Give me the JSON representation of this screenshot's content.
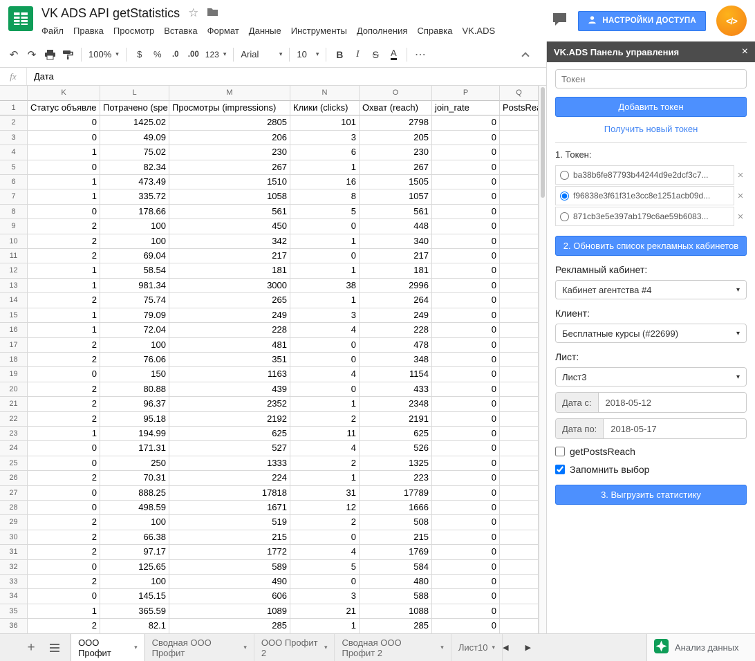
{
  "colors": {
    "accent_blue": "#4d90fe",
    "sheets_green": "#0F9D58",
    "addon_orange": "#F57F17",
    "panel_header_gray": "#4c4c4c"
  },
  "icons": {
    "star": "☆",
    "undo": "↶",
    "redo": "↷",
    "caret_down": "▾",
    "prev": "◀",
    "next": "▶",
    "plus": "+"
  },
  "header": {
    "title": "VK ADS API getStatistics",
    "menus": [
      "Файл",
      "Правка",
      "Просмотр",
      "Вставка",
      "Формат",
      "Данные",
      "Инструменты",
      "Дополнения",
      "Справка",
      "VK.ADS"
    ],
    "share_button": "НАСТРОЙКИ ДОСТУПА",
    "addon_icon": "</>"
  },
  "toolbar": {
    "zoom": "100%",
    "currency": "$",
    "percent": "%",
    "decrease_decimal": ".0",
    "increase_decimal": ".00",
    "more_formats": "123",
    "font": "Arial",
    "font_size": "10",
    "bold": "B",
    "italic": "I",
    "strikethrough": "S",
    "text_color": "A",
    "more": "⋯"
  },
  "formula_bar": {
    "fx": "fx",
    "value": "Дата"
  },
  "grid": {
    "columns": [
      "K",
      "L",
      "M",
      "N",
      "O",
      "P",
      "Q"
    ],
    "header_row": {
      "row": 1,
      "cells": [
        "Статус объявле",
        "Потрачено (spe",
        "Просмотры (impressions)",
        "Клики (clicks)",
        "Охват (reach)",
        "join_rate",
        "PostsRea"
      ]
    },
    "rows": [
      {
        "n": 2,
        "cells": [
          "0",
          "1425.02",
          "2805",
          "101",
          "2798",
          "0",
          ""
        ]
      },
      {
        "n": 3,
        "cells": [
          "0",
          "49.09",
          "206",
          "3",
          "205",
          "0",
          ""
        ]
      },
      {
        "n": 4,
        "cells": [
          "1",
          "75.02",
          "230",
          "6",
          "230",
          "0",
          ""
        ]
      },
      {
        "n": 5,
        "cells": [
          "0",
          "82.34",
          "267",
          "1",
          "267",
          "0",
          ""
        ]
      },
      {
        "n": 6,
        "cells": [
          "1",
          "473.49",
          "1510",
          "16",
          "1505",
          "0",
          ""
        ]
      },
      {
        "n": 7,
        "cells": [
          "1",
          "335.72",
          "1058",
          "8",
          "1057",
          "0",
          ""
        ]
      },
      {
        "n": 8,
        "cells": [
          "0",
          "178.66",
          "561",
          "5",
          "561",
          "0",
          ""
        ]
      },
      {
        "n": 9,
        "cells": [
          "2",
          "100",
          "450",
          "0",
          "448",
          "0",
          ""
        ]
      },
      {
        "n": 10,
        "cells": [
          "2",
          "100",
          "342",
          "1",
          "340",
          "0",
          ""
        ]
      },
      {
        "n": 11,
        "cells": [
          "2",
          "69.04",
          "217",
          "0",
          "217",
          "0",
          ""
        ]
      },
      {
        "n": 12,
        "cells": [
          "1",
          "58.54",
          "181",
          "1",
          "181",
          "0",
          ""
        ]
      },
      {
        "n": 13,
        "cells": [
          "1",
          "981.34",
          "3000",
          "38",
          "2996",
          "0",
          ""
        ]
      },
      {
        "n": 14,
        "cells": [
          "2",
          "75.74",
          "265",
          "1",
          "264",
          "0",
          ""
        ]
      },
      {
        "n": 15,
        "cells": [
          "1",
          "79.09",
          "249",
          "3",
          "249",
          "0",
          ""
        ]
      },
      {
        "n": 16,
        "cells": [
          "1",
          "72.04",
          "228",
          "4",
          "228",
          "0",
          ""
        ]
      },
      {
        "n": 17,
        "cells": [
          "2",
          "100",
          "481",
          "0",
          "478",
          "0",
          ""
        ]
      },
      {
        "n": 18,
        "cells": [
          "2",
          "76.06",
          "351",
          "0",
          "348",
          "0",
          ""
        ]
      },
      {
        "n": 19,
        "cells": [
          "0",
          "150",
          "1163",
          "4",
          "1154",
          "0",
          ""
        ]
      },
      {
        "n": 20,
        "cells": [
          "2",
          "80.88",
          "439",
          "0",
          "433",
          "0",
          ""
        ]
      },
      {
        "n": 21,
        "cells": [
          "2",
          "96.37",
          "2352",
          "1",
          "2348",
          "0",
          ""
        ]
      },
      {
        "n": 22,
        "cells": [
          "2",
          "95.18",
          "2192",
          "2",
          "2191",
          "0",
          ""
        ]
      },
      {
        "n": 23,
        "cells": [
          "1",
          "194.99",
          "625",
          "11",
          "625",
          "0",
          ""
        ]
      },
      {
        "n": 24,
        "cells": [
          "0",
          "171.31",
          "527",
          "4",
          "526",
          "0",
          ""
        ]
      },
      {
        "n": 25,
        "cells": [
          "0",
          "250",
          "1333",
          "2",
          "1325",
          "0",
          ""
        ]
      },
      {
        "n": 26,
        "cells": [
          "2",
          "70.31",
          "224",
          "1",
          "223",
          "0",
          ""
        ]
      },
      {
        "n": 27,
        "cells": [
          "0",
          "888.25",
          "17818",
          "31",
          "17789",
          "0",
          ""
        ]
      },
      {
        "n": 28,
        "cells": [
          "0",
          "498.59",
          "1671",
          "12",
          "1666",
          "0",
          ""
        ]
      },
      {
        "n": 29,
        "cells": [
          "2",
          "100",
          "519",
          "2",
          "508",
          "0",
          ""
        ]
      },
      {
        "n": 30,
        "cells": [
          "2",
          "66.38",
          "215",
          "0",
          "215",
          "0",
          ""
        ]
      },
      {
        "n": 31,
        "cells": [
          "2",
          "97.17",
          "1772",
          "4",
          "1769",
          "0",
          ""
        ]
      },
      {
        "n": 32,
        "cells": [
          "0",
          "125.65",
          "589",
          "5",
          "584",
          "0",
          ""
        ]
      },
      {
        "n": 33,
        "cells": [
          "2",
          "100",
          "490",
          "0",
          "480",
          "0",
          ""
        ]
      },
      {
        "n": 34,
        "cells": [
          "0",
          "145.15",
          "606",
          "3",
          "588",
          "0",
          ""
        ]
      },
      {
        "n": 35,
        "cells": [
          "1",
          "365.59",
          "1089",
          "21",
          "1088",
          "0",
          ""
        ]
      },
      {
        "n": 36,
        "cells": [
          "2",
          "82.1",
          "285",
          "1",
          "285",
          "0",
          ""
        ]
      }
    ]
  },
  "sidebar": {
    "panel_title": "VK.ADS Панель управления",
    "close": "×",
    "token_placeholder": "Токен",
    "add_token_button": "Добавить токен",
    "new_token_link": "Получить новый токен",
    "token_section_label": "1. Токен:",
    "remove_token": "×",
    "tokens": [
      {
        "value": "ba38b6fe87793b44244d9e2dcf3c7...",
        "selected": false
      },
      {
        "value": "f96838e3f61f31e3cc8e1251acb09d...",
        "selected": true
      },
      {
        "value": "871cb3e5e397ab179c6ae59b6083...",
        "selected": false
      }
    ],
    "update_button": "2. Обновить список рекламных кабинетов",
    "cabinet_label": "Рекламный кабинет:",
    "cabinet_value": "Кабинет агентства #4",
    "client_label": "Клиент:",
    "client_value": "Бесплатные курсы (#22699)",
    "sheet_label": "Лист:",
    "sheet_value": "Лист3",
    "date_from_label": "Дата с:",
    "date_from_value": "2018-05-12",
    "date_to_label": "Дата по:",
    "date_to_value": "2018-05-17",
    "checkbox_posts_reach": {
      "label": "getPostsReach",
      "checked": false
    },
    "checkbox_remember": {
      "label": "Запомнить выбор",
      "checked": true
    },
    "export_button": "3. Выгрузить статистику"
  },
  "tabbar": {
    "tabs": [
      {
        "label": "ООО Профит",
        "active": true
      },
      {
        "label": "Сводная ООО Профит",
        "active": false
      },
      {
        "label": "ООО Профит 2",
        "active": false
      },
      {
        "label": "Сводная ООО Профит 2",
        "active": false
      },
      {
        "label": "Лист10",
        "active": false
      }
    ],
    "explore_label": "Анализ данных"
  }
}
